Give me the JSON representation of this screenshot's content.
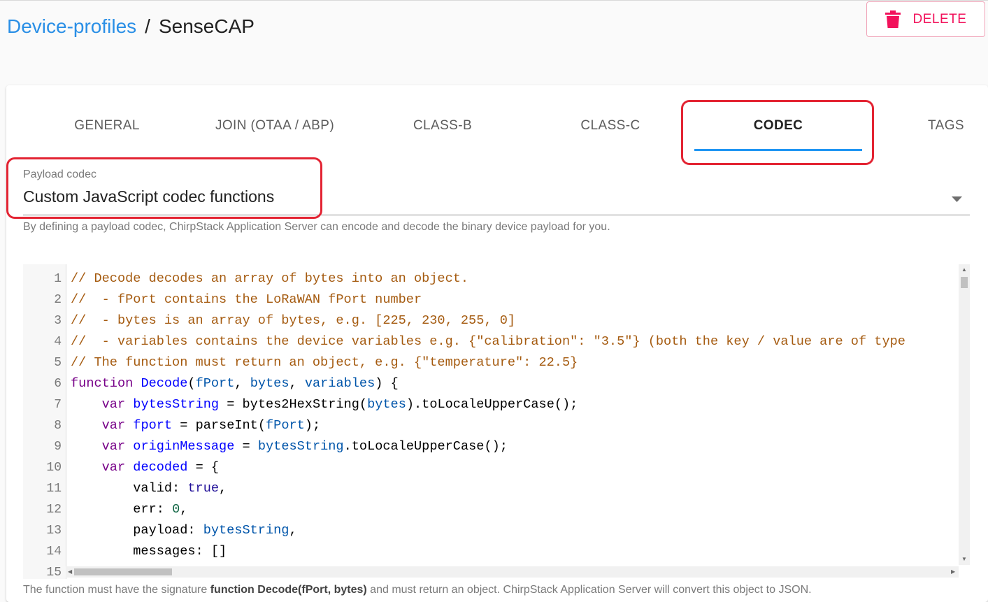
{
  "breadcrumb": {
    "parent": "Device-profiles",
    "separator": "/",
    "current": "SenseCAP"
  },
  "header": {
    "delete_label": "DELETE"
  },
  "tabs": [
    {
      "label": "GENERAL",
      "active": false
    },
    {
      "label": "JOIN (OTAA / ABP)",
      "active": false
    },
    {
      "label": "CLASS-B",
      "active": false
    },
    {
      "label": "CLASS-C",
      "active": false
    },
    {
      "label": "CODEC",
      "active": true
    },
    {
      "label": "TAGS",
      "active": false
    }
  ],
  "codec": {
    "label": "Payload codec",
    "value": "Custom JavaScript codec functions",
    "helper": "By defining a payload codec, ChirpStack Application Server can encode and decode the binary device payload for you."
  },
  "editor": {
    "line_numbers": [
      "1",
      "2",
      "3",
      "4",
      "5",
      "6",
      "7",
      "8",
      "9",
      "10",
      "11",
      "12",
      "13",
      "14",
      "15"
    ],
    "lines": [
      "// Decode decodes an array of bytes into an object.",
      "//  - fPort contains the LoRaWAN fPort number",
      "//  - bytes is an array of bytes, e.g. [225, 230, 255, 0]",
      "//  - variables contains the device variables e.g. {\"calibration\": \"3.5\"} (both the key / value are of type",
      "// The function must return an object, e.g. {\"temperature\": 22.5}",
      "function Decode(fPort, bytes, variables) {",
      "    var bytesString = bytes2HexString(bytes).toLocaleUpperCase();",
      "    var fport = parseInt(fPort);",
      "    var originMessage = bytesString.toLocaleUpperCase();",
      "    var decoded = {",
      "        valid: true,",
      "        err: 0,",
      "        payload: bytesString,",
      "        messages: []"
    ]
  },
  "footer_helper": {
    "prefix": "The function must have the signature ",
    "signature": "function Decode(fPort, bytes)",
    "suffix": " and must return an object. ChirpStack Application Server will convert this object to JSON."
  },
  "colors": {
    "link": "#2a8fe6",
    "danger": "#f2125b",
    "tab_indicator": "#2196f3",
    "highlight_box": "#e32433",
    "comment": "#a55b10",
    "keyword": "#770088",
    "def": "#0000ff",
    "variable": "#0055aa",
    "atom": "#221199",
    "number": "#116644"
  },
  "icons": {
    "delete": "trash-icon",
    "dropdown": "caret-down-icon"
  }
}
